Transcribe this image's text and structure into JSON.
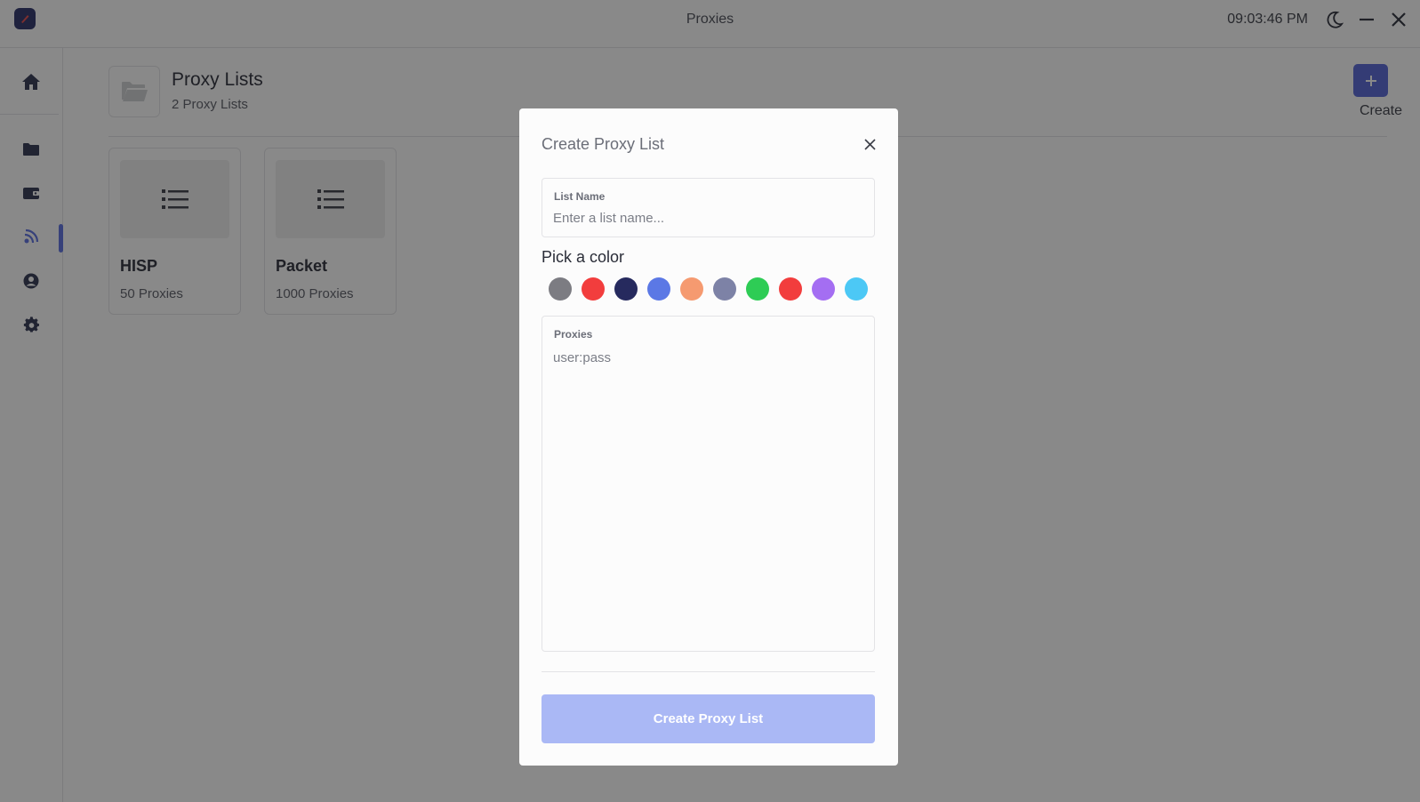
{
  "window": {
    "title": "Proxies",
    "clock": "09:03:46 PM"
  },
  "sidebar": {
    "items": [
      {
        "icon": "home-icon"
      },
      {
        "icon": "folder-icon"
      },
      {
        "icon": "wallet-icon"
      },
      {
        "icon": "proxy-signal-icon",
        "active": true
      },
      {
        "icon": "user-icon"
      },
      {
        "icon": "gear-icon"
      }
    ]
  },
  "header": {
    "title": "Proxy Lists",
    "subtitle": "2 Proxy Lists",
    "create_label": "Create"
  },
  "cards": [
    {
      "name": "HISP",
      "count": "50 Proxies"
    },
    {
      "name": "Packet",
      "count": "1000 Proxies"
    }
  ],
  "modal": {
    "title": "Create Proxy List",
    "list_name": {
      "label": "List Name",
      "placeholder": "Enter a list name...",
      "value": ""
    },
    "pick_color_label": "Pick a color",
    "colors": [
      "#7c7c82",
      "#f23d3d",
      "#262a5e",
      "#5b78e5",
      "#f59a70",
      "#7d82a6",
      "#2ecc55",
      "#f23d3d",
      "#a46ef2",
      "#4cc8f5"
    ],
    "proxies": {
      "label": "Proxies",
      "placeholder": "user:pass",
      "value": ""
    },
    "submit_label": "Create Proxy List"
  },
  "theme": {
    "accent": "#5565d6",
    "submit_disabled": "#aab8f5"
  }
}
